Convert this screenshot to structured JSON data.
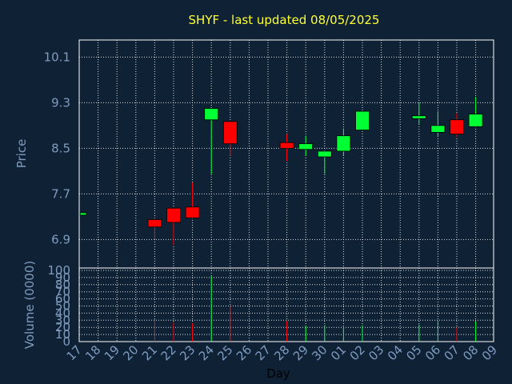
{
  "chart_data": [
    {
      "type": "candlestick",
      "title": "SHYF - last updated 08/05/2025",
      "ylabel": "Price",
      "xlabel": "Day",
      "ylim": [
        6.4,
        10.4
      ],
      "yticks": [
        "6.9",
        "7.7",
        "8.5",
        "9.3",
        "10.1"
      ],
      "x_tick_labels": [
        "17",
        "18",
        "19",
        "20",
        "21",
        "22",
        "23",
        "24",
        "25",
        "26",
        "27",
        "28",
        "29",
        "30",
        "01",
        "02",
        "03",
        "04",
        "05",
        "06",
        "07",
        "08",
        "09"
      ],
      "grid": true,
      "colors": {
        "up": "#00ff33",
        "down": "#ff0000",
        "background": "#0f2135",
        "grid": "#ffffff",
        "title": "#ffff33",
        "tick": "#7f9cbf"
      },
      "candles": [
        {
          "day": "17",
          "open": 7.37,
          "high": 7.37,
          "low": 7.37,
          "close": 7.37,
          "volume": 0
        },
        {
          "day": "21",
          "open": 7.25,
          "high": 7.3,
          "low": 6.9,
          "close": 7.12,
          "volume": 31
        },
        {
          "day": "22",
          "open": 7.45,
          "high": 7.45,
          "low": 6.8,
          "close": 7.2,
          "volume": 27
        },
        {
          "day": "23",
          "open": 7.47,
          "high": 7.9,
          "low": 7.3,
          "close": 7.28,
          "volume": 26
        },
        {
          "day": "24",
          "open": 9.0,
          "high": 9.2,
          "low": 8.05,
          "close": 9.2,
          "volume": 92
        },
        {
          "day": "25",
          "open": 8.97,
          "high": 8.97,
          "low": 8.37,
          "close": 8.58,
          "volume": 50
        },
        {
          "day": "28",
          "open": 8.6,
          "high": 8.75,
          "low": 8.28,
          "close": 8.5,
          "volume": 29
        },
        {
          "day": "29",
          "open": 8.48,
          "high": 8.72,
          "low": 8.37,
          "close": 8.58,
          "volume": 22
        },
        {
          "day": "30",
          "open": 8.35,
          "high": 8.45,
          "low": 8.05,
          "close": 8.45,
          "volume": 23
        },
        {
          "day": "01",
          "open": 8.45,
          "high": 8.85,
          "low": 8.38,
          "close": 8.72,
          "volume": 21
        },
        {
          "day": "02",
          "open": 8.82,
          "high": 9.15,
          "low": 8.82,
          "close": 9.15,
          "volume": 23
        },
        {
          "day": "05",
          "open": 9.02,
          "high": 9.3,
          "low": 8.93,
          "close": 9.07,
          "volume": 24
        },
        {
          "day": "06",
          "open": 8.78,
          "high": 9.15,
          "low": 8.7,
          "close": 8.9,
          "volume": 29
        },
        {
          "day": "07",
          "open": 9.0,
          "high": 9.12,
          "low": 8.7,
          "close": 8.75,
          "volume": 20
        },
        {
          "day": "08",
          "open": 8.88,
          "high": 9.4,
          "low": 8.88,
          "close": 9.1,
          "volume": 28
        }
      ]
    },
    {
      "type": "bar",
      "ylabel": "Volume (0000)",
      "ylim": [
        0,
        100
      ],
      "yticks": [
        "0",
        "10",
        "20",
        "30",
        "40",
        "50",
        "60",
        "70",
        "80",
        "90",
        "100"
      ],
      "values_source": "candles[].volume"
    }
  ]
}
